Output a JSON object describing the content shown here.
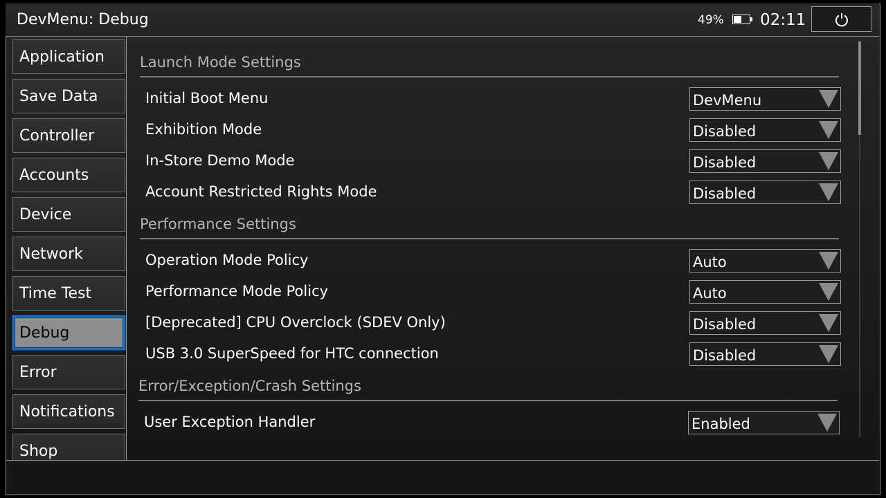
{
  "header": {
    "title": "DevMenu: Debug",
    "battery_percent": "49%",
    "battery_level": 0.49,
    "clock": "02:11"
  },
  "sidebar": {
    "items": [
      {
        "label": "Application"
      },
      {
        "label": "Save Data"
      },
      {
        "label": "Controller"
      },
      {
        "label": "Accounts"
      },
      {
        "label": "Device"
      },
      {
        "label": "Network"
      },
      {
        "label": "Time Test"
      },
      {
        "label": "Debug",
        "active": true
      },
      {
        "label": "Error"
      },
      {
        "label": "Notifications"
      },
      {
        "label": "Shop"
      }
    ]
  },
  "sections": [
    {
      "title": "Launch Mode Settings",
      "settings": [
        {
          "label": "Initial Boot Menu",
          "value": "DevMenu"
        },
        {
          "label": "Exhibition Mode",
          "value": "Disabled"
        },
        {
          "label": "In-Store Demo Mode",
          "value": "Disabled"
        },
        {
          "label": "Account Restricted Rights Mode",
          "value": "Disabled"
        }
      ]
    },
    {
      "title": "Performance Settings",
      "settings": [
        {
          "label": "Operation Mode Policy",
          "value": "Auto"
        },
        {
          "label": "Performance Mode Policy",
          "value": "Auto"
        },
        {
          "label": "[Deprecated] CPU Overclock (SDEV Only)",
          "value": "Disabled"
        },
        {
          "label": "USB 3.0 SuperSpeed for HTC connection",
          "value": "Disabled"
        }
      ]
    },
    {
      "title": "Error/Exception/Crash Settings",
      "settings": [
        {
          "label": "User Exception Handler",
          "value": "Enabled"
        }
      ]
    }
  ],
  "colors": {
    "active_border": "#1a6fc2",
    "active_fill": "#8e8e8e",
    "section_title": "#b4b4b4"
  },
  "icons": {
    "power": "power-icon",
    "battery": "battery-icon",
    "dropdown": "triangle-down-icon"
  }
}
